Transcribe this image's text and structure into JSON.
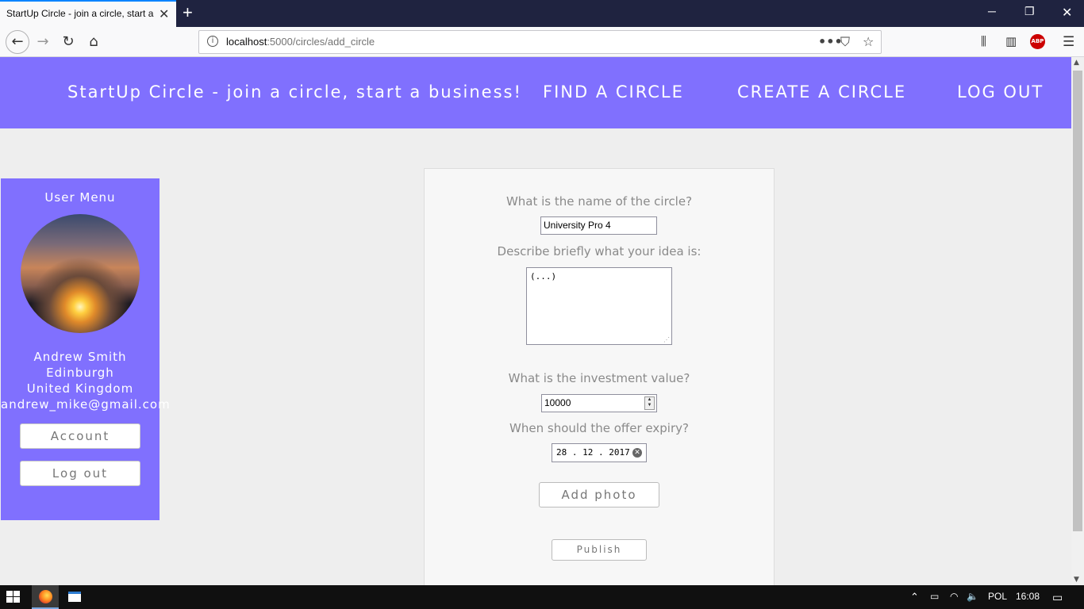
{
  "browser": {
    "tab_title": "StartUp Circle - join a circle, start a business!",
    "url_host": "localhost",
    "url_path": ":5000/circles/add_circle"
  },
  "header": {
    "brand": "StartUp Circle - join a circle, start a business!",
    "nav": [
      "FIND A CIRCLE",
      "CREATE A CIRCLE",
      "LOG OUT"
    ]
  },
  "sidebar": {
    "title": "User Menu",
    "name": "Andrew Smith",
    "city": "Edinburgh",
    "country": "United Kingdom",
    "email": "andrew_mike@gmail.com",
    "account_button": "Account",
    "logout_button": "Log out"
  },
  "form": {
    "q_name": "What is the name of the circle?",
    "name_value": "University Pro 4",
    "q_idea": "Describe briefly what your idea is:",
    "idea_value": "(...)",
    "q_investment": "What is the investment value?",
    "investment_value": "10000",
    "q_expiry": "When should the offer expiry?",
    "expiry_value": "28 . 12 . 2017",
    "add_photo": "Add photo",
    "publish": "Publish"
  },
  "taskbar": {
    "language": "POL",
    "time": "16:08"
  }
}
